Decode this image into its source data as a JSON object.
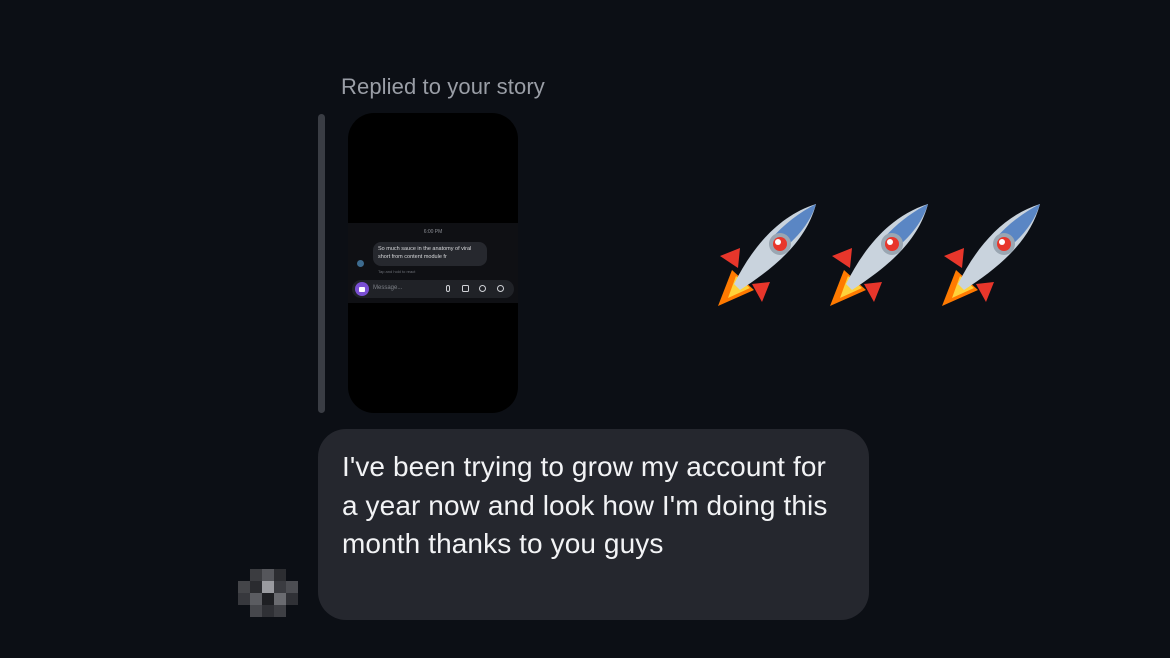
{
  "reply": {
    "caption": "Replied to your story"
  },
  "story_preview": {
    "time": "6:00 PM",
    "bubble_text": "So much sauce in the anatomy of viral short from content module fr",
    "tap_hint": "Tap and hold to react",
    "input_placeholder": "Message..."
  },
  "emoji_reaction": {
    "emoji": "rocket",
    "count": 3
  },
  "message": {
    "text": "I've been trying to grow my account for a year now and look how I'm doing this month thanks to you guys"
  },
  "colors": {
    "background": "#0c0f15",
    "bubble": "#25272e",
    "caption": "#9a9ea6",
    "text": "#f2f3f5",
    "accent": "#7a4fd3"
  },
  "icons": {
    "camera": "camera-icon",
    "mic": "mic-icon",
    "image": "image-icon",
    "sticker": "sticker-icon",
    "add": "add-icon"
  }
}
